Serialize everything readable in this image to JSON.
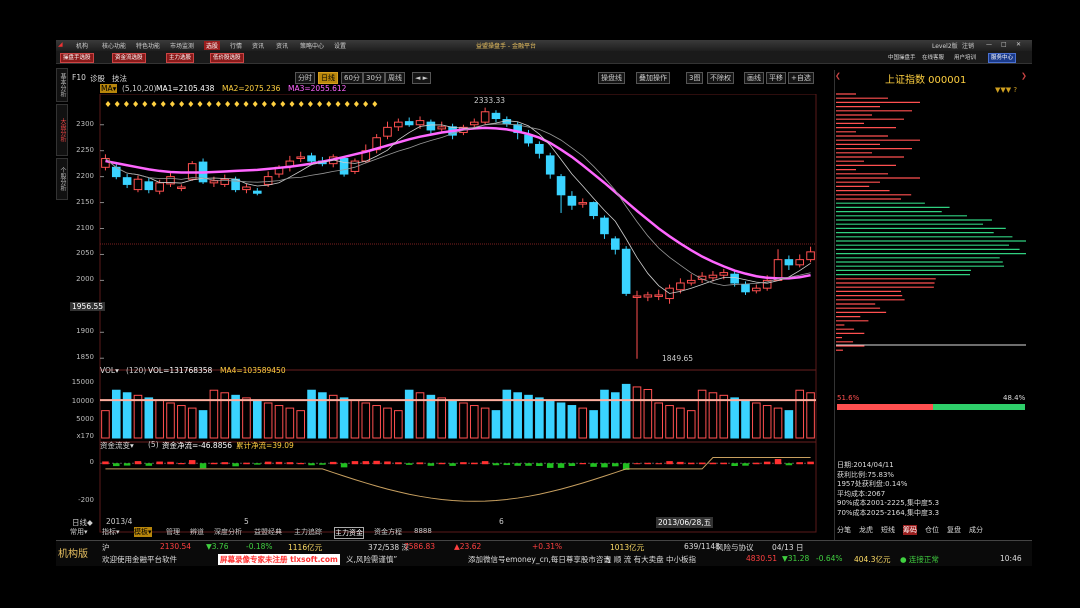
{
  "menu": {
    "items": [
      "机构",
      "核心功能",
      "特色功能",
      "市场监测",
      "选股",
      "行情",
      "资讯",
      "资讯",
      "策略中心",
      "设置"
    ],
    "active_index": 4,
    "app_title": "益盟操盘手 - 金融平台",
    "right_links": [
      "Level2版",
      "注销"
    ]
  },
  "brandbar": {
    "pills": [
      "操盘手选股",
      "资金流选股",
      "主力选股",
      "低价股选股"
    ],
    "right": [
      "中国操盘手",
      "在线客服",
      "用户培训"
    ],
    "center_btn": "服务中心"
  },
  "chart_header": {
    "f10": "F10",
    "diag": "诊股",
    "tech": "技法",
    "ma_label": "MA▾",
    "ma_params": "(5,10,20)",
    "ma1": "MA1=2105.438",
    "ma2": "MA2=2075.236",
    "ma3": "MA3=2055.612",
    "arrow_up": "↑"
  },
  "period_tabs": [
    "分时",
    "日线",
    "60分",
    "30分",
    "周线",
    "◄ ►"
  ],
  "period_selected": 1,
  "right_tools": [
    "操盘线",
    "叠加操作",
    "3图",
    "不除权",
    "画线",
    "平移",
    "+自选"
  ],
  "price_axis": [
    "2300",
    "2250",
    "2200",
    "2150",
    "2100",
    "2050",
    "2000",
    "1950",
    "1900",
    "1850"
  ],
  "current_price_label": "1956.55",
  "high_label": "2333.33",
  "low_label": "1849.65",
  "vol_header": {
    "label": "VOL▾",
    "param": "(120)",
    "vol": "VOL=131768358",
    "ma4": "MA4=103589450"
  },
  "vol_axis": [
    "15000",
    "10000",
    "5000",
    "x170"
  ],
  "flow_header": {
    "label": "资金流变▾",
    "param": "(5)",
    "net": "资金净流=-46.8856",
    "accum": "累计净流=39.09"
  },
  "flow_axis": [
    "0",
    "-200"
  ],
  "x_axis": {
    "labels": [
      "2013/4",
      "5",
      "6"
    ],
    "cursor_date": "2013/06/28,五"
  },
  "bottom_tabs": [
    "常用▾",
    "指标▾",
    "模板▾",
    "管理",
    "辨道",
    "深度分析",
    "益盟经典",
    "主力追踪",
    "主力资金",
    "资金方程",
    "8888"
  ],
  "bottom_tab_selected": 8,
  "left_tabs": [
    "基本分析",
    "大盘分析",
    "个股分析"
  ],
  "right_panel": {
    "title": "上证指数 000001",
    "left_pct": "51.6%",
    "right_pct": "48.4%",
    "info": [
      "日期:2014/04/11",
      "获利比例:75.83%",
      "1957处获利盘:0.14%",
      "平均成本:2067",
      "90%成本2001-2225,集中度5.3",
      "70%成本2025-2164,集中度3.3"
    ],
    "tabs": [
      "分笔",
      "龙虎",
      "短线",
      "筹码",
      "仓位",
      "复盘",
      "成分"
    ],
    "selected_tab": 3
  },
  "status_bar": {
    "brand": "机构版",
    "row1": [
      {
        "t": "沪",
        "c": "#ddd"
      },
      {
        "t": "2130.54",
        "c": "#ff4040"
      },
      {
        "t": "▼3.76",
        "c": "#40d040"
      },
      {
        "t": "-0.18%",
        "c": "#40d040"
      },
      {
        "t": "1116亿元",
        "c": "#ffdd66"
      },
      {
        "t": "372/538 深",
        "c": "#ddd"
      },
      {
        "t": "7586.83",
        "c": "#ff4040"
      },
      {
        "t": "▲23.62",
        "c": "#ff4040"
      },
      {
        "t": "+0.31%",
        "c": "#ff4040"
      },
      {
        "t": "1013亿元",
        "c": "#ffdd66"
      },
      {
        "t": "639/1148",
        "c": "#ddd"
      },
      {
        "t": "风险与协议",
        "c": "#ddd"
      },
      {
        "t": "04/13 日",
        "c": "#ddd"
      }
    ],
    "row2": [
      {
        "t": "欢迎使用金融平台软件",
        "c": "#ddd"
      },
      {
        "t": "屏幕录像专家未注册 tlxsoft.com",
        "c": "#ff3030"
      },
      {
        "t": "义,风险需谨慎”",
        "c": "#ddd"
      },
      {
        "t": "添加微信号emoney_cn,每日尊享股市咨询",
        "c": "#ddd"
      },
      {
        "t": "五 顺 流 有大卖盘 中小板指",
        "c": "#ddd"
      },
      {
        "t": "4830.51",
        "c": "#ff4040"
      },
      {
        "t": "▼31.28",
        "c": "#40d040"
      },
      {
        "t": "-0.64%",
        "c": "#40d040"
      },
      {
        "t": "404.3亿元",
        "c": "#ffdd66"
      },
      {
        "t": "● 连接正常",
        "c": "#40d040"
      },
      {
        "t": "10:46",
        "c": "#ddd"
      }
    ]
  },
  "chart_data": {
    "type": "candlestick",
    "candles": [
      [
        2218,
        2235,
        2243,
        2212
      ],
      [
        2218,
        2200,
        2226,
        2195
      ],
      [
        2198,
        2185,
        2205,
        2178
      ],
      [
        2175,
        2195,
        2202,
        2170
      ],
      [
        2190,
        2175,
        2198,
        2168
      ],
      [
        2172,
        2188,
        2194,
        2166
      ],
      [
        2186,
        2200,
        2208,
        2180
      ],
      [
        2178,
        2180,
        2185,
        2172
      ],
      [
        2195,
        2225,
        2230,
        2192
      ],
      [
        2228,
        2190,
        2235,
        2186
      ],
      [
        2188,
        2192,
        2200,
        2180
      ],
      [
        2185,
        2195,
        2204,
        2180
      ],
      [
        2195,
        2175,
        2200,
        2170
      ],
      [
        2175,
        2180,
        2186,
        2168
      ],
      [
        2172,
        2168,
        2178,
        2164
      ],
      [
        2185,
        2200,
        2210,
        2180
      ],
      [
        2205,
        2218,
        2222,
        2198
      ],
      [
        2220,
        2230,
        2240,
        2210
      ],
      [
        2235,
        2238,
        2248,
        2228
      ],
      [
        2240,
        2230,
        2246,
        2222
      ],
      [
        2230,
        2225,
        2238,
        2220
      ],
      [
        2225,
        2238,
        2243,
        2218
      ],
      [
        2235,
        2205,
        2238,
        2200
      ],
      [
        2210,
        2230,
        2235,
        2205
      ],
      [
        2230,
        2250,
        2262,
        2226
      ],
      [
        2252,
        2275,
        2282,
        2245
      ],
      [
        2278,
        2295,
        2306,
        2272
      ],
      [
        2296,
        2305,
        2312,
        2288
      ],
      [
        2306,
        2300,
        2314,
        2296
      ],
      [
        2300,
        2308,
        2316,
        2292
      ],
      [
        2305,
        2290,
        2310,
        2282
      ],
      [
        2292,
        2296,
        2306,
        2285
      ],
      [
        2296,
        2280,
        2302,
        2272
      ],
      [
        2285,
        2295,
        2300,
        2280
      ],
      [
        2300,
        2305,
        2312,
        2294
      ],
      [
        2305,
        2325,
        2333,
        2300
      ],
      [
        2322,
        2312,
        2328,
        2305
      ],
      [
        2310,
        2302,
        2316,
        2296
      ],
      [
        2300,
        2285,
        2305,
        2272
      ],
      [
        2280,
        2265,
        2290,
        2258
      ],
      [
        2262,
        2245,
        2268,
        2235
      ],
      [
        2240,
        2205,
        2246,
        2196
      ],
      [
        2200,
        2165,
        2205,
        2130
      ],
      [
        2162,
        2145,
        2172,
        2136
      ],
      [
        2148,
        2150,
        2158,
        2140
      ],
      [
        2150,
        2125,
        2152,
        2118
      ],
      [
        2120,
        2090,
        2125,
        2080
      ],
      [
        2080,
        2060,
        2085,
        2050
      ],
      [
        2060,
        1975,
        2066,
        1970
      ],
      [
        1970,
        1970,
        1980,
        1849
      ],
      [
        1968,
        1972,
        1978,
        1960
      ],
      [
        1972,
        1972,
        1982,
        1962
      ],
      [
        1965,
        1985,
        1992,
        1955
      ],
      [
        1982,
        1995,
        2004,
        1975
      ],
      [
        1995,
        2000,
        2012,
        1990
      ],
      [
        2002,
        2008,
        2016,
        1995
      ],
      [
        2005,
        2010,
        2018,
        1998
      ],
      [
        2010,
        2015,
        2022,
        2002
      ],
      [
        2012,
        1995,
        2018,
        1988
      ],
      [
        1992,
        1978,
        1998,
        1972
      ],
      [
        1980,
        1985,
        1992,
        1975
      ],
      [
        1985,
        2000,
        2010,
        1980
      ],
      [
        2000,
        2040,
        2060,
        2000
      ],
      [
        2040,
        2030,
        2048,
        2020
      ],
      [
        2030,
        2040,
        2050,
        2025
      ],
      [
        2040,
        2055,
        2065,
        2035
      ]
    ],
    "y_range": [
      1835,
      2340
    ],
    "ma3": [
      2230,
      2226,
      2222,
      2218,
      2214,
      2211,
      2209,
      2208,
      2208,
      2208,
      2209,
      2210,
      2211,
      2212,
      2213,
      2215,
      2217,
      2219,
      2222,
      2225,
      2229,
      2233,
      2238,
      2243,
      2248,
      2254,
      2260,
      2266,
      2272,
      2277,
      2281,
      2285,
      2288,
      2291,
      2293,
      2294,
      2293,
      2291,
      2287,
      2282,
      2275,
      2265,
      2252,
      2238,
      2222,
      2205,
      2188,
      2170,
      2152,
      2134,
      2117,
      2100,
      2085,
      2071,
      2058,
      2046,
      2036,
      2027,
      2019,
      2013,
      2008,
      2005,
      2004,
      2004,
      2006,
      2010
    ],
    "vol_range": [
      0,
      17000
    ],
    "flow_range": [
      -330,
      80
    ]
  }
}
